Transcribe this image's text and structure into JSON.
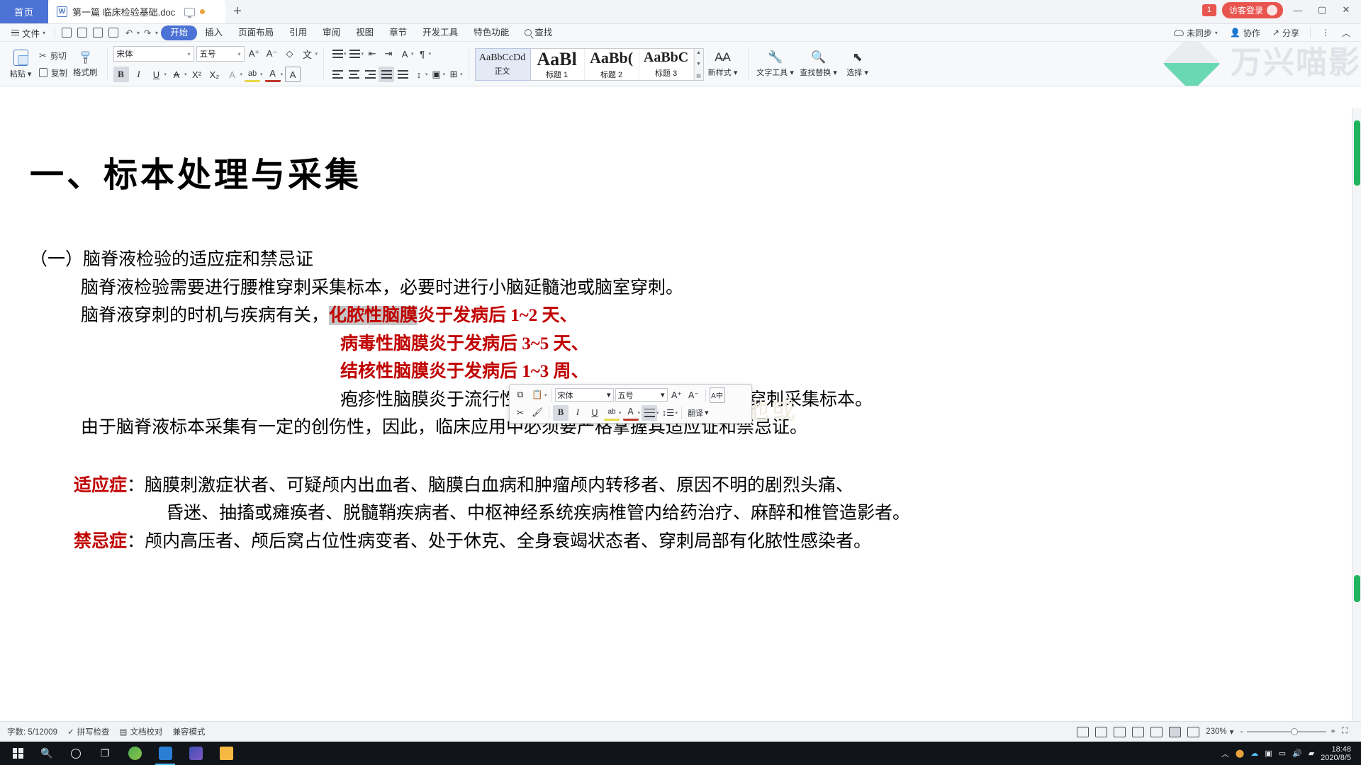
{
  "window": {
    "home_tab": "首页",
    "document_tab": "第一篇  临床检验基础.doc",
    "new_tab_icon": "+",
    "notification_count": "1",
    "login_label": "访客登录",
    "minimize": "—",
    "maximize": "▢",
    "close": "✕"
  },
  "menubar": {
    "file": "文件",
    "quick_access": [
      "save-icon",
      "save-as-icon",
      "print-icon",
      "print-preview-icon",
      "undo-icon",
      "redo-icon",
      "customize-icon"
    ],
    "items": [
      {
        "label": "开始",
        "active": true
      },
      {
        "label": "插入",
        "active": false
      },
      {
        "label": "页面布局",
        "active": false
      },
      {
        "label": "引用",
        "active": false
      },
      {
        "label": "审阅",
        "active": false
      },
      {
        "label": "视图",
        "active": false
      },
      {
        "label": "章节",
        "active": false
      },
      {
        "label": "开发工具",
        "active": false
      },
      {
        "label": "特色功能",
        "active": false
      },
      {
        "label": "查找",
        "active": false
      }
    ],
    "right": [
      {
        "label": "未同步",
        "icon": "cloud-icon"
      },
      {
        "label": "协作",
        "icon": "collaborate-icon"
      },
      {
        "label": "分享",
        "icon": "share-icon"
      }
    ],
    "more": "⋮",
    "collapse": "︿"
  },
  "ribbon": {
    "paste": "粘贴",
    "cut": "剪切",
    "copy": "复制",
    "format_painter": "格式刷",
    "font_name": "宋体",
    "font_size": "五号",
    "grow_font": "A⁺",
    "shrink_font": "A⁻",
    "clear_format": "清除格式",
    "pinyin": "拼音指南",
    "bold": "B",
    "italic": "I",
    "underline": "U",
    "strikethrough": "A",
    "superscript": "X²",
    "subscript": "X₂",
    "text_effect": "A",
    "highlight": "ab",
    "font_color": "A",
    "char_border": "A",
    "styles": [
      {
        "preview": "AaBbCcDd",
        "name": "正文",
        "selected": true
      },
      {
        "preview": "AaBl",
        "name": "标题 1",
        "selected": false
      },
      {
        "preview": "AaBb(",
        "name": "标题 2",
        "selected": false
      },
      {
        "preview": "AaBbC",
        "name": "标题 3",
        "selected": false
      }
    ],
    "new_style": "新样式",
    "text_tools": "文字工具",
    "find_replace": "查找替换",
    "select": "选择",
    "watermark_text": "万兴喵影"
  },
  "mini_toolbar": {
    "font_name": "宋体",
    "font_size": "五号",
    "grow_font": "A⁺",
    "shrink_font": "A⁻",
    "pinyin_icon": "A中",
    "copy_icon": "copy-icon",
    "paste_icon": "paste-icon",
    "cut_icon": "cut-icon",
    "painter_icon": "format-painter-icon",
    "bold": "B",
    "italic": "I",
    "underline": "U",
    "highlight": "ab",
    "font_color": "A",
    "align_icon": "align-icon",
    "line_spacing_icon": "line-spacing-icon",
    "translate": "翻译"
  },
  "document": {
    "title": "一、标本处理与采集",
    "paragraphs": [
      {
        "id": "heading1",
        "indent": 0,
        "text": "（一）脑脊液检验的适应症和禁忌证",
        "color": "black"
      },
      {
        "id": "line-puncture",
        "indent": 1,
        "text": "脑脊液检验需要进行腰椎穿刺采集标本，必要时进行小脑延髓池或脑室穿刺。",
        "color": "black"
      },
      {
        "id": "line-timing",
        "indent": 1,
        "text": "脑脊液穿刺的时机与疾病有关，",
        "color": "black"
      },
      {
        "id": "line-purulent",
        "indent": 2,
        "text": "化脓性脑膜炎于发病后 1~2 天、",
        "color": "red",
        "highlight_prefix": "化脓性脑膜"
      },
      {
        "id": "line-viral",
        "indent": 2,
        "text": "病毒性脑膜炎于发病后 3~5 天、",
        "color": "red"
      },
      {
        "id": "line-tubercular",
        "indent": 2,
        "text": "结核性脑膜炎于发病后 1~3 周、",
        "color": "red"
      },
      {
        "id": "line-herpes",
        "indent": 2,
        "text": "疱疹性脑膜炎于流行性感冒前驱症状期开始后 5~7 天穿刺采集标本。",
        "color": "black"
      },
      {
        "id": "line-trauma",
        "indent": 1,
        "text": "由于脑脊液标本采集有一定的创伤性，因此，临床应用中必须要严格掌握其适应证和禁忌证。",
        "color": "black"
      }
    ],
    "indications": {
      "label": "适应症",
      "colon": "：",
      "line1": "脑膜刺激症状者、可疑颅内出血者、脑膜白血病和肿瘤颅内转移者、原因不明的剧烈头痛、",
      "line2": "昏迷、抽搐或瘫痪者、脱髓鞘疾病者、中枢神经系统疾病椎管内给药治疗、麻醉和椎管造影者。"
    },
    "contraindications": {
      "label": "禁忌症",
      "colon": "：",
      "line1": "颅内高压者、颅后窝占位性病变者、处于休克、全身衰竭状态者、穿刺局部有化脓性感染者。"
    },
    "doc_watermark": "必要时进行小脑延髓池或"
  },
  "statusbar": {
    "word_count": "字数: 5/12009",
    "spell_check": "拼写检查",
    "proofread": "文档校对",
    "compat_mode": "兼容模式",
    "zoom_level": "230%",
    "zoom_out": "-",
    "zoom_in": "+",
    "view_icons": [
      "fullscreen-icon",
      "page-view-icon",
      "edit-view-icon",
      "outline-icon",
      "web-view-icon",
      "reading-icon",
      "night-mode-icon"
    ]
  },
  "taskbar": {
    "start_icon": "windows-icon",
    "search_icon": "search-icon",
    "cortana_icon": "cortana-icon",
    "taskview_icon": "task-view-icon",
    "apps": [
      "chrome-icon",
      "wps-icon",
      "editor-icon",
      "explorer-icon"
    ],
    "time": "18:48",
    "date": "2020/8/5",
    "tray_icons": [
      "chevron-up-icon",
      "shield-icon",
      "cloud-icon",
      "speaker-icon",
      "battery-icon",
      "volume-icon",
      "network-icon"
    ]
  },
  "colors": {
    "accent_blue": "#4b72d4",
    "red_text": "#c00000",
    "highlight_gray": "#c6c6c6",
    "scroll_green": "#22b35e",
    "badge_red": "#e8554e"
  }
}
